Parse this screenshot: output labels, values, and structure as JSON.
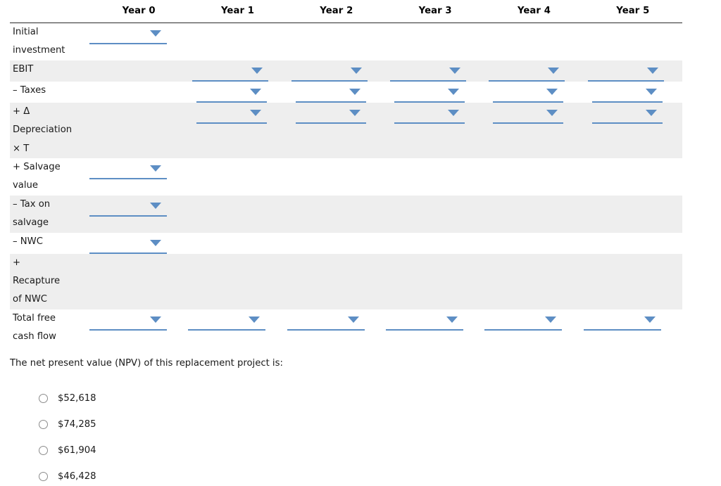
{
  "table": {
    "row_label_header": "",
    "columns": [
      "Year 0",
      "Year 1",
      "Year 2",
      "Year 3",
      "Year 4",
      "Year 5"
    ],
    "rows": [
      {
        "label": "Initial\ninvestment",
        "banded": false,
        "selects": [
          true,
          false,
          false,
          false,
          false,
          false
        ],
        "values": [
          "",
          "",
          "",
          "",
          "",
          ""
        ]
      },
      {
        "label": "EBIT",
        "banded": true,
        "selects": [
          false,
          true,
          true,
          true,
          true,
          true
        ],
        "values": [
          "",
          "",
          "",
          "",
          "",
          ""
        ]
      },
      {
        "label": " – Taxes",
        "banded": false,
        "selects": [
          false,
          true,
          true,
          true,
          true,
          true
        ],
        "values": [
          "",
          "",
          "",
          "",
          "",
          ""
        ]
      },
      {
        "label": "+ Δ\nDepreciation\n× T",
        "banded": true,
        "selects": [
          false,
          true,
          true,
          true,
          true,
          true
        ],
        "values": [
          "",
          "",
          "",
          "",
          "",
          ""
        ]
      },
      {
        "label": " + Salvage\nvalue",
        "banded": false,
        "selects": [
          true,
          false,
          false,
          false,
          false,
          false
        ],
        "values": [
          "",
          "",
          "",
          "",
          "",
          ""
        ]
      },
      {
        "label": " – Tax on\nsalvage",
        "banded": true,
        "selects": [
          true,
          false,
          false,
          false,
          false,
          false
        ],
        "values": [
          "",
          "",
          "",
          "",
          "",
          ""
        ]
      },
      {
        "label": " – NWC",
        "banded": false,
        "selects": [
          true,
          false,
          false,
          false,
          false,
          false
        ],
        "values": [
          "",
          "",
          "",
          "",
          "",
          ""
        ]
      },
      {
        "label": " +\nRecapture\nof NWC",
        "banded": true,
        "selects": [
          false,
          false,
          false,
          false,
          false,
          false
        ],
        "values": [
          "",
          "",
          "",
          "",
          "",
          ""
        ]
      },
      {
        "label": "Total free\ncash flow",
        "banded": false,
        "selects": [
          true,
          true,
          true,
          true,
          true,
          true
        ],
        "values": [
          "",
          "",
          "",
          "",
          "",
          ""
        ]
      }
    ]
  },
  "question": {
    "prompt": "The net present value (NPV) of this replacement project is:",
    "options": [
      {
        "label": "$52,618",
        "selected": false
      },
      {
        "label": "$74,285",
        "selected": false
      },
      {
        "label": "$61,904",
        "selected": false
      },
      {
        "label": "$46,428",
        "selected": false
      }
    ]
  },
  "icons": {
    "caret": "chevron-down-icon",
    "radio": "radio-button-icon"
  },
  "colors": {
    "select_accent": "#5d8ec4",
    "band": "#eeeeee",
    "rule": "#2b2b2b",
    "text": "#1a1a1a"
  }
}
